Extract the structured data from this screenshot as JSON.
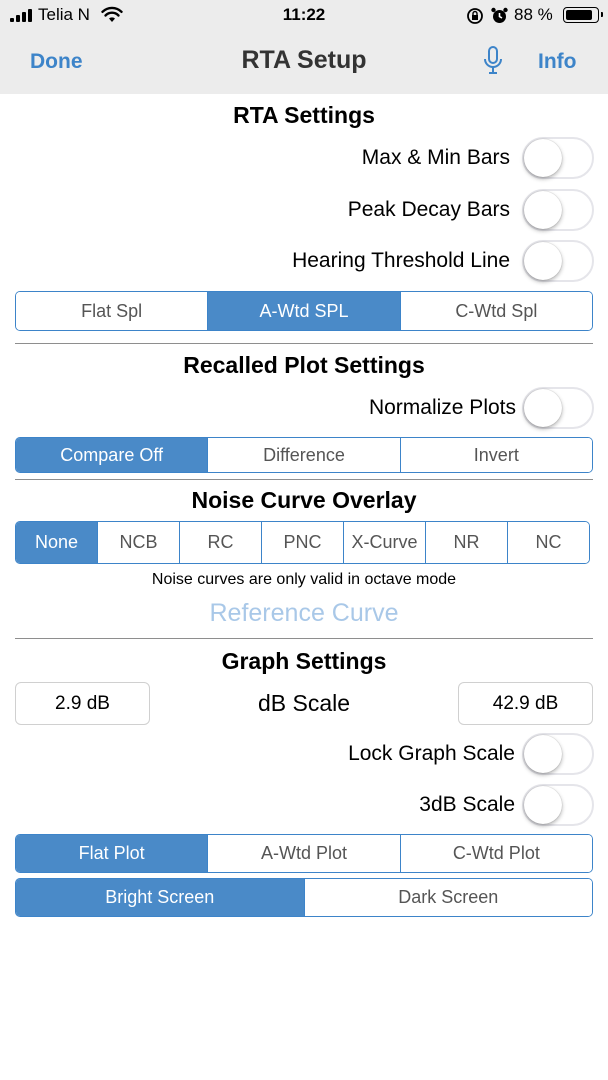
{
  "status_bar": {
    "carrier": "Telia N",
    "time": "11:22",
    "battery_percent": "88 %",
    "battery_level": 0.88
  },
  "nav": {
    "done": "Done",
    "title": "RTA Setup",
    "info": "Info",
    "mic_icon": "microphone-icon"
  },
  "rta_settings": {
    "title": "RTA Settings",
    "toggles": [
      {
        "label": "Max & Min Bars",
        "on": false
      },
      {
        "label": "Peak Decay Bars",
        "on": false
      },
      {
        "label": "Hearing Threshold Line",
        "on": false
      }
    ],
    "weighting": {
      "options": [
        "Flat Spl",
        "A-Wtd SPL",
        "C-Wtd Spl"
      ],
      "selected": "A-Wtd SPL"
    }
  },
  "recalled": {
    "title": "Recalled Plot Settings",
    "normalize_label": "Normalize Plots",
    "normalize_on": false,
    "compare": {
      "options": [
        "Compare Off",
        "Difference",
        "Invert"
      ],
      "selected": "Compare Off"
    }
  },
  "noise": {
    "title": "Noise Curve Overlay",
    "options": [
      "None",
      "NCB",
      "RC",
      "PNC",
      "X-Curve",
      "NR",
      "NC"
    ],
    "selected": "None",
    "note": "Noise curves are only valid in octave mode",
    "reference_curve": "Reference Curve"
  },
  "graph": {
    "title": "Graph Settings",
    "min_value": "2.9 dB",
    "scale_label": "dB Scale",
    "max_value": "42.9 dB",
    "lock_label": "Lock Graph Scale",
    "lock_on": false,
    "three_db_label": "3dB Scale",
    "three_db_on": false,
    "plot": {
      "options": [
        "Flat Plot",
        "A-Wtd Plot",
        "C-Wtd Plot"
      ],
      "selected": "Flat Plot"
    },
    "screen": {
      "options": [
        "Bright Screen",
        "Dark Screen"
      ],
      "selected": "Bright Screen"
    }
  },
  "colors": {
    "accent": "#3d84c9",
    "selected_fill": "#4a8ac8",
    "reference_disabled": "#a9c8e8"
  }
}
